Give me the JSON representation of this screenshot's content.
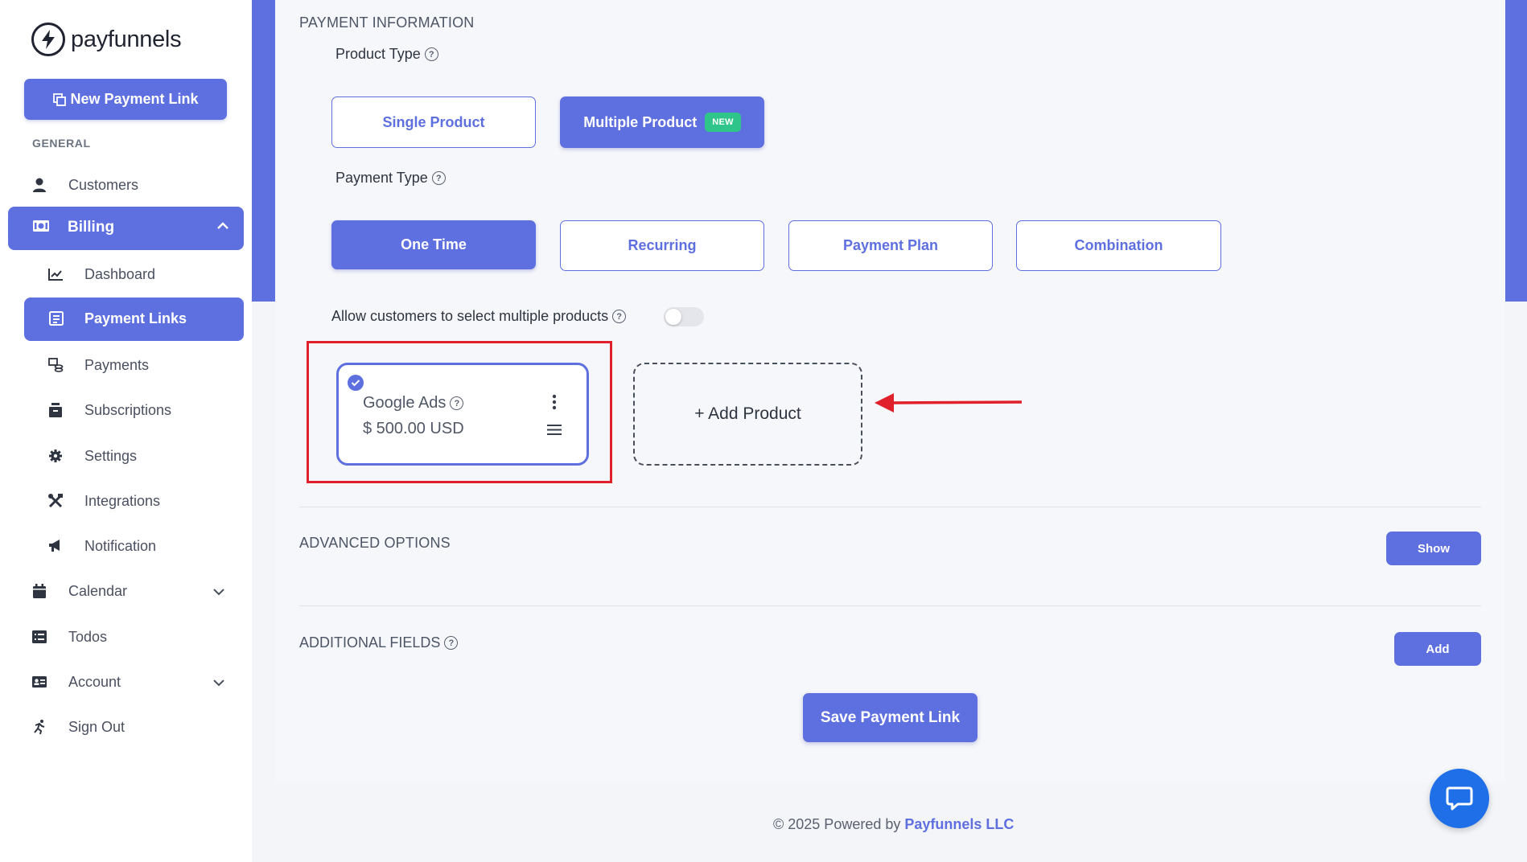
{
  "brand": {
    "name": "payfunnels"
  },
  "sidebar": {
    "new_link_label": "New Payment Link",
    "section_general": "GENERAL",
    "customers": "Customers",
    "billing": "Billing",
    "dashboard": "Dashboard",
    "payment_links": "Payment Links",
    "payments": "Payments",
    "subscriptions": "Subscriptions",
    "settings": "Settings",
    "integrations": "Integrations",
    "notification": "Notification",
    "calendar": "Calendar",
    "todos": "Todos",
    "account": "Account",
    "sign_out": "Sign Out"
  },
  "main": {
    "payment_information": "PAYMENT INFORMATION",
    "product_type_label": "Product Type",
    "product_types": {
      "single": "Single Product",
      "multiple": "Multiple Product",
      "new_badge": "NEW"
    },
    "selected_product_type": "Multiple Product",
    "payment_type_label": "Payment Type",
    "payment_types": {
      "one_time": "One Time",
      "recurring": "Recurring",
      "payment_plan": "Payment Plan",
      "combination": "Combination"
    },
    "selected_payment_type": "One Time",
    "allow_multiple_label": "Allow customers to select multiple products",
    "allow_multiple_enabled": false,
    "product": {
      "name": "Google Ads",
      "price": "$ 500.00 USD",
      "selected": true
    },
    "add_product_label": "+ Add Product",
    "advanced_options": "ADVANCED OPTIONS",
    "show_label": "Show",
    "additional_fields": "ADDITIONAL FIELDS",
    "add_label": "Add",
    "save_label": "Save Payment Link"
  },
  "footer": {
    "prefix": "© 2025 Powered by ",
    "brand": "Payfunnels LLC"
  },
  "colors": {
    "accent": "#5e6fe0",
    "new_badge": "#2fc58a",
    "highlight": "#e0202a",
    "chat": "#1f6fe8"
  }
}
